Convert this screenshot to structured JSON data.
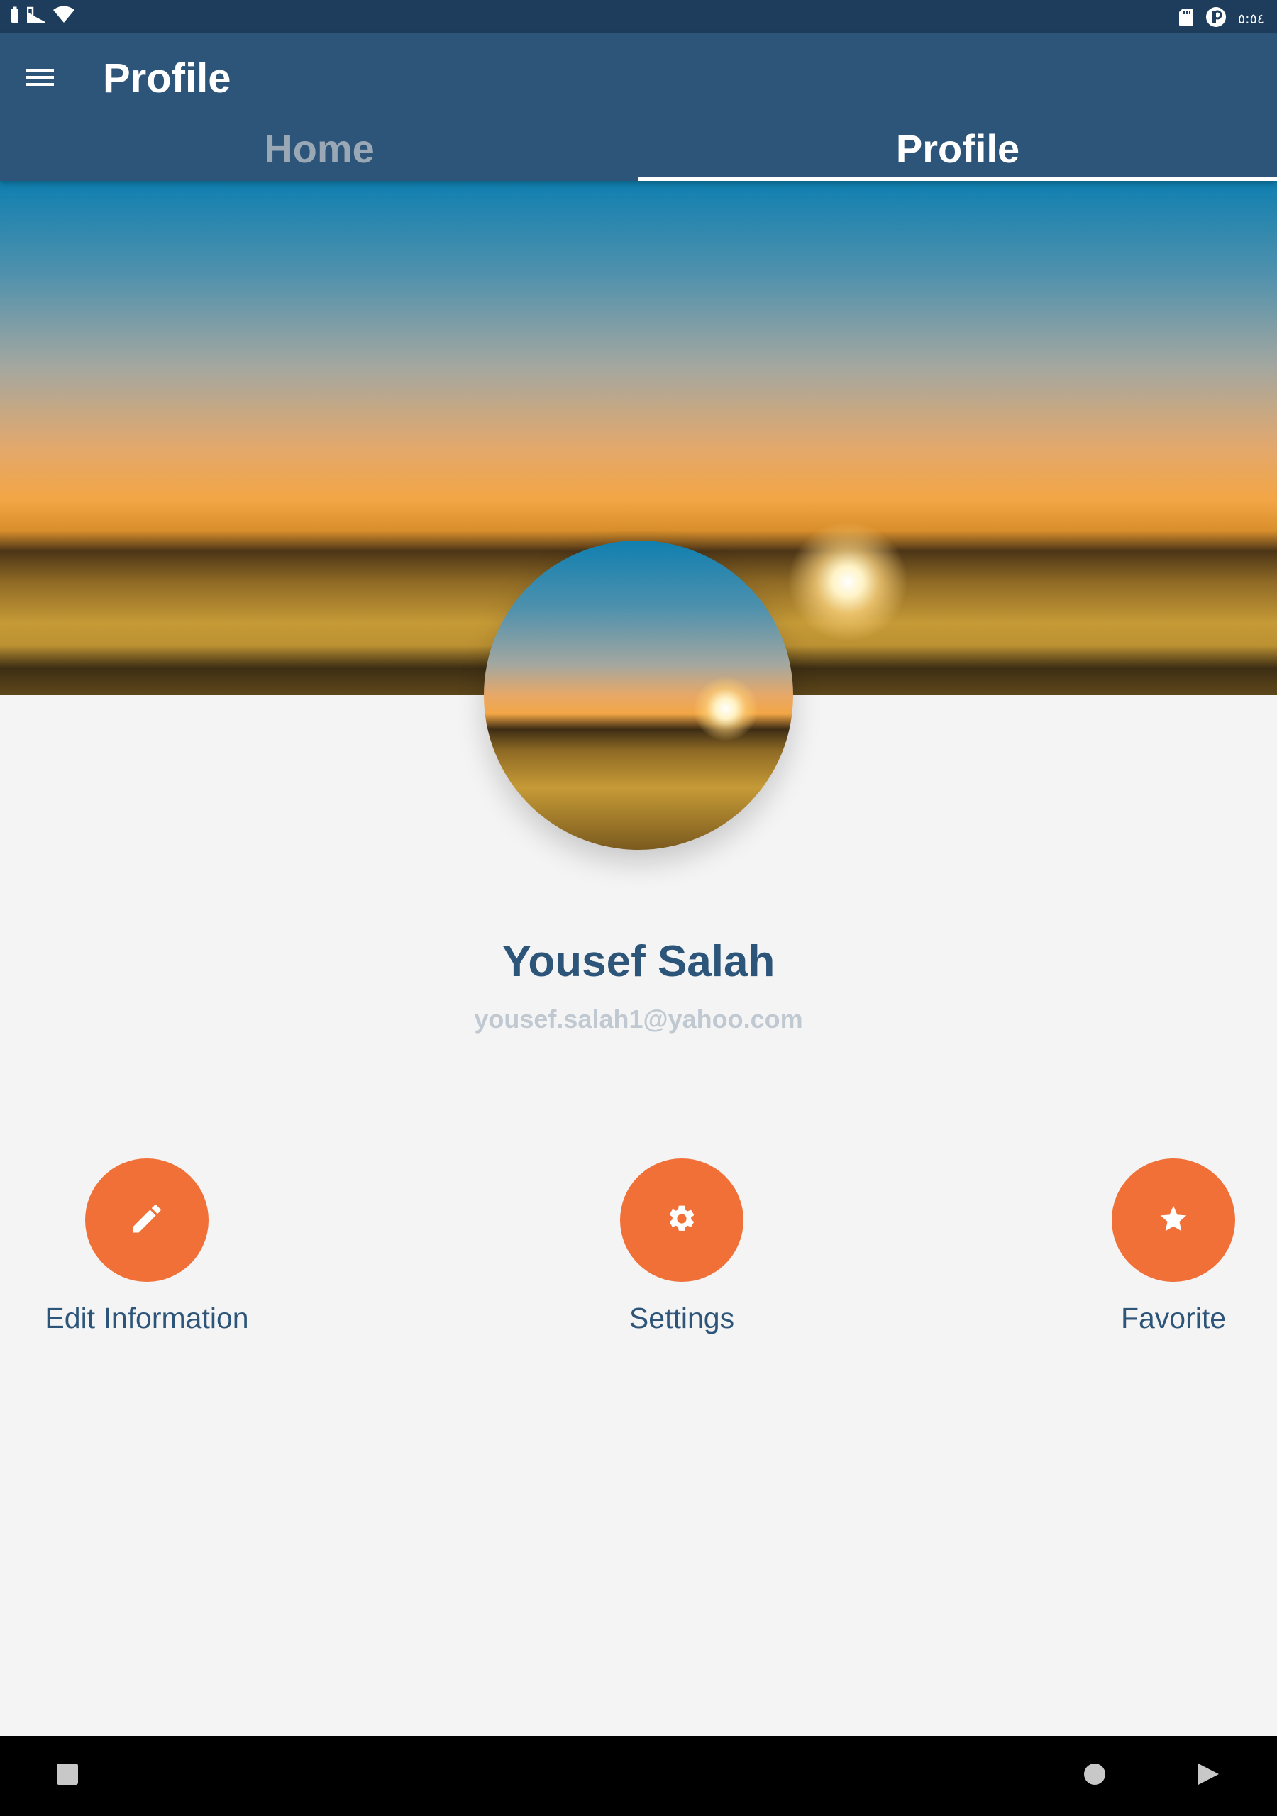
{
  "status_bar": {
    "time": "٥:٥٤",
    "left_icons": [
      "battery-icon",
      "signal-icon",
      "wifi-icon"
    ],
    "right_icons": [
      "sd-card-icon",
      "app-notification-icon"
    ]
  },
  "toolbar": {
    "title": "Profile",
    "menu_icon": "menu-icon"
  },
  "tabs": [
    {
      "label": "Home",
      "active": false
    },
    {
      "label": "Profile",
      "active": true
    }
  ],
  "profile": {
    "name": "Yousef Salah",
    "email": "yousef.salah1@yahoo.com"
  },
  "actions": [
    {
      "label": "Edit Information",
      "icon": "pencil-icon"
    },
    {
      "label": "Settings",
      "icon": "gear-icon"
    },
    {
      "label": "Favorite",
      "icon": "star-icon"
    }
  ],
  "colors": {
    "primary": "#2c5579",
    "status_bar": "#1e3d5c",
    "accent": "#f07038",
    "background": "#f4f4f4",
    "email_text": "#c0c9d2"
  },
  "nav_bar": {
    "buttons": [
      "recents-icon",
      "home-icon",
      "back-icon"
    ]
  }
}
